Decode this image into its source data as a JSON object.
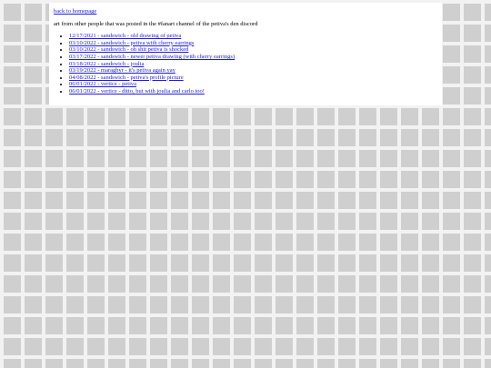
{
  "back_link": "back to homepage",
  "intro": "art from other people that was posted in the #fanart channel of the petiva's den discord",
  "items": [
    "12/17/2021 - sandswich - old drawing of petiva",
    "03/10/2022 - sandswich - petiva with cherry earrings",
    "03/10/2022 - sandswich - oh shit petiva is shocked",
    "03/17/2022 - sandswich - newer petiva drawing (with cherry earrings)",
    "03/18/2022 - sandswich - joulia",
    "03/19/2022 - maragbyr - it's petiva again yay",
    "04/08/2022 - sandswich - petiva's profile picture",
    "06/01/2022 - vertice - petiva",
    "06/01/2022 - vertice - ditto, but with joulia and carlo too!"
  ]
}
